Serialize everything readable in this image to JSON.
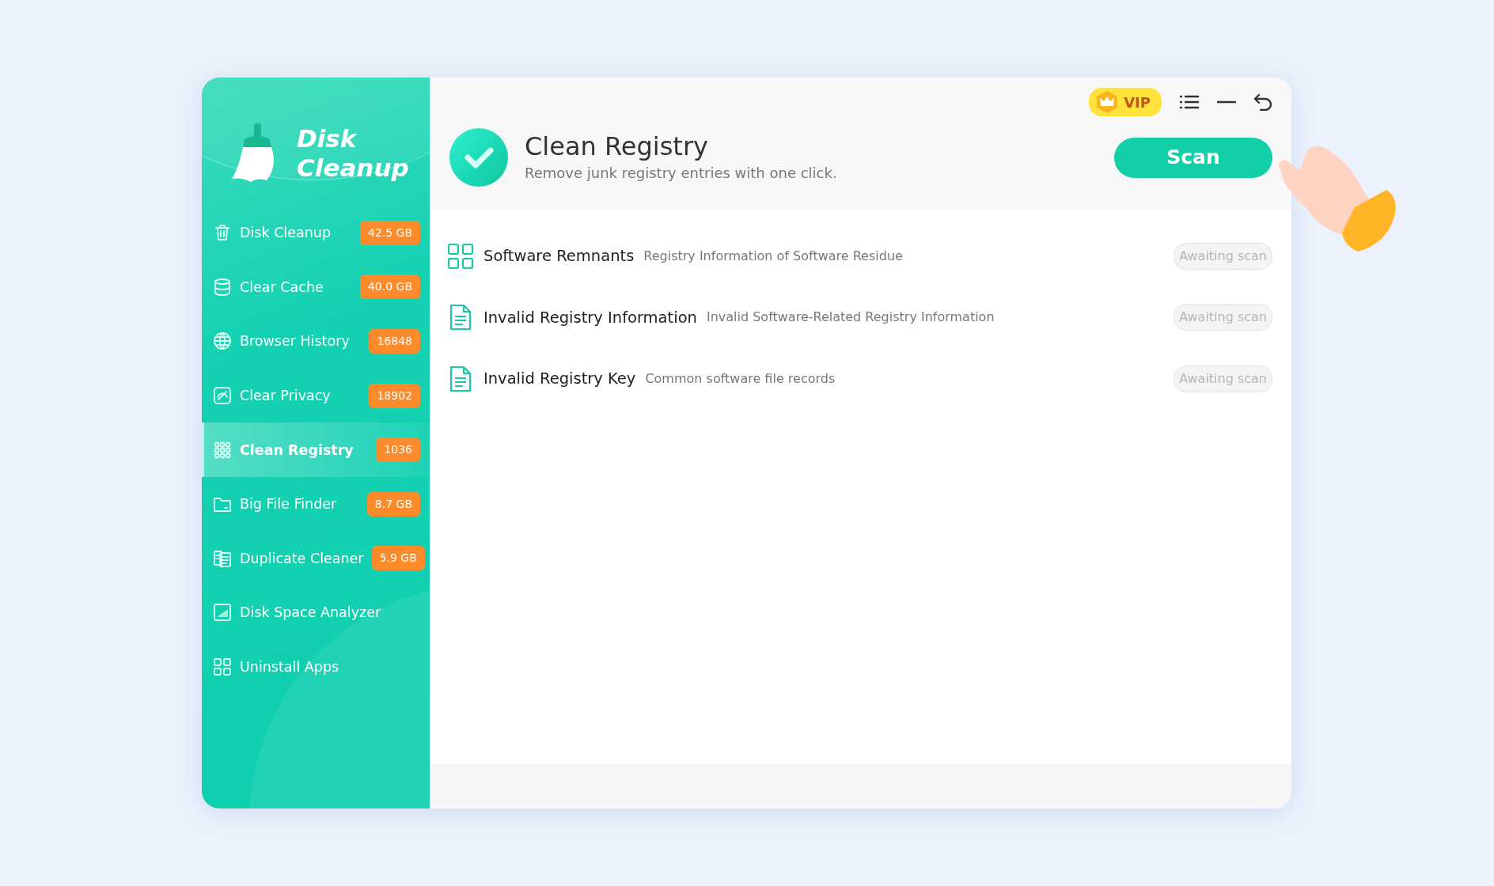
{
  "app": {
    "logo_line_1": "Disk",
    "logo_line_2": "Cleanup"
  },
  "sidebar": {
    "items": [
      {
        "label": "Disk Cleanup",
        "badge": "42.5 GB",
        "selected": false
      },
      {
        "label": "Clear Cache",
        "badge": "40.0 GB",
        "selected": false
      },
      {
        "label": "Browser History",
        "badge": "16848",
        "selected": false
      },
      {
        "label": "Clear Privacy",
        "badge": "18902",
        "selected": false
      },
      {
        "label": "Clean Registry",
        "badge": "1036",
        "selected": true
      },
      {
        "label": "Big File Finder",
        "badge": "8.7 GB",
        "selected": false
      },
      {
        "label": "Duplicate Cleaner",
        "badge": "5.9 GB",
        "selected": false
      },
      {
        "label": "Disk Space Analyzer",
        "selected": false
      },
      {
        "label": "Uninstall Apps",
        "selected": false
      }
    ]
  },
  "toolbar": {
    "vip": "VIP"
  },
  "header": {
    "title": "Clean Registry",
    "subtitle": "Remove junk registry entries with one click.",
    "button": "Scan"
  },
  "rows": [
    {
      "title": "Software Remnants",
      "description": "Registry Information of Software Residue",
      "status": "Awaiting scan"
    },
    {
      "title": "Invalid Registry Information",
      "description": "Invalid Software-Related Registry Information",
      "status": "Awaiting scan"
    },
    {
      "title": "Invalid Registry Key",
      "description": "Common software file records",
      "status": "Awaiting scan"
    }
  ]
}
